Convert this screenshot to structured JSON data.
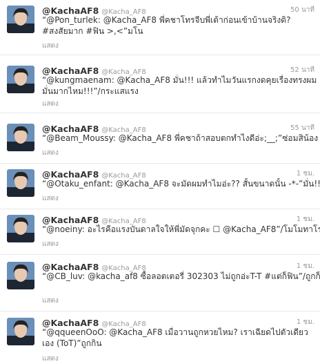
{
  "tweets": [
    {
      "name": "@KachaAF8",
      "handle": "@Kacha_AF8",
      "time": "50 นาที",
      "text": "“@Pon_turlek: @Kacha_AF8 พี่คชาโทรจีบพี่เต้าก่อนเข้าบ้านจริงดิ? #สงสัยมาก #ฟิน >,<”มโน",
      "show": "แสดง"
    },
    {
      "name": "@KachaAF8",
      "handle": "@Kacha_AF8",
      "time": "52 นาที",
      "text": "“@kungmaenam: @Kacha_AF8 มั่น!!! แล้วทำไมวันแรกงดคุยเรื่องทรงผม มั่นมากไหม!!!”/กระแสแรง",
      "show": "แสดง"
    },
    {
      "name": "@KachaAF8",
      "handle": "@Kacha_AF8",
      "time": "55 นาที",
      "text": "“@Beam_Moussy: @Kacha_AF8 พี่คชาถ้าสอบตกทำไงดีอ่ะ;__;”ซ่อมสิน้อง",
      "show": "แสดง"
    },
    {
      "name": "@KachaAF8",
      "handle": "@Kacha_AF8",
      "time": "1 ชม.",
      "text": "“@Otaku_enfant: @Kacha_AF8 จะมัดผมทำไมอ่ะ?? สั้นขนาดนั้น -*-”มั่น!!!",
      "show": "แสดง"
    },
    {
      "name": "@KachaAF8",
      "handle": "@Kacha_AF8",
      "time": "1 ชม.",
      "text": "“@noeiny: อะไรคือแรงบันดาลใจให้พี่มัดจุกคะ ☐ @Kacha_AF8”/โมโมทาโร่",
      "show": "แสดง"
    },
    {
      "name": "@KachaAF8",
      "handle": "@Kacha_AF8",
      "time": "1 ชม.",
      "text": "“@CB_luv: @kacha_af8 ซื้อลอตเตอรี่ 302303 ไม่ถูกอ่ะT-T #แต่ก็ฟิน”/ถูกก็บ้า",
      "show": "แสดง"
    },
    {
      "name": "@KachaAF8",
      "handle": "@Kacha_AF8",
      "time": "1 ชม.",
      "text": "“@qqueenOoO: @Kacha_AF8 เมื่อวานถูกหวยไหม? เราเฉียดไปตัวเดียวเอง (ToT)”ถูกกิน",
      "show": "แสดง"
    }
  ]
}
